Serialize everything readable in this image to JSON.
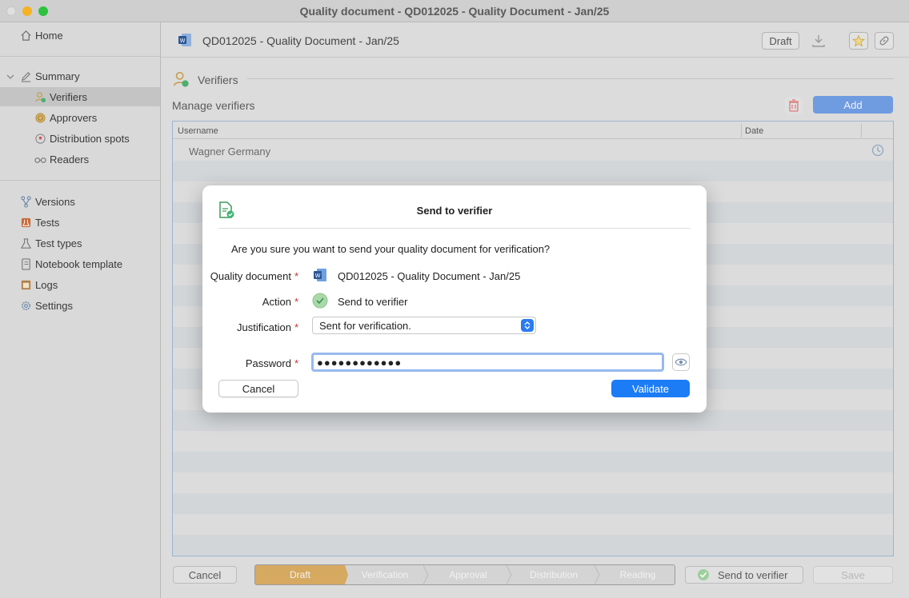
{
  "window": {
    "title": "Quality document - QD012025 - Quality Document - Jan/25"
  },
  "sidebar": {
    "home": "Home",
    "summary": "Summary",
    "summary_items": [
      "Verifiers",
      "Approvers",
      "Distribution spots",
      "Readers"
    ],
    "tools": [
      "Versions",
      "Tests",
      "Test types",
      "Notebook template",
      "Logs",
      "Settings"
    ]
  },
  "doc": {
    "title": "QD012025 - Quality Document - Jan/25",
    "status": "Draft"
  },
  "section": {
    "title": "Verifiers",
    "manage_label": "Manage verifiers",
    "add_label": "Add"
  },
  "table": {
    "headers": [
      "Username",
      "Date"
    ],
    "rows": [
      {
        "username": "Wagner Germany"
      }
    ]
  },
  "bottom": {
    "cancel_label": "Cancel",
    "stages": [
      "Draft",
      "Verification",
      "Approval",
      "Distribution",
      "Reading"
    ],
    "send_label": "Send to verifier",
    "save_label": "Save"
  },
  "modal": {
    "title": "Send to verifier",
    "question": "Are you sure you want to send your quality document for verification?",
    "doc_label": "Quality document",
    "doc_value": "QD012025 - Quality Document - Jan/25",
    "action_label": "Action",
    "action_value": "Send to verifier",
    "justification_label": "Justification",
    "justification_value": "Sent for verification.",
    "password_label": "Password",
    "password_value": "●●●●●●●●●●●●",
    "required_mark": "*",
    "cancel_label": "Cancel",
    "validate_label": "Validate"
  },
  "colors": {
    "accent": "#1b7cf5",
    "stage_active": "#d6a960",
    "add_button": "#6f9be0",
    "required": "#d0312d"
  }
}
